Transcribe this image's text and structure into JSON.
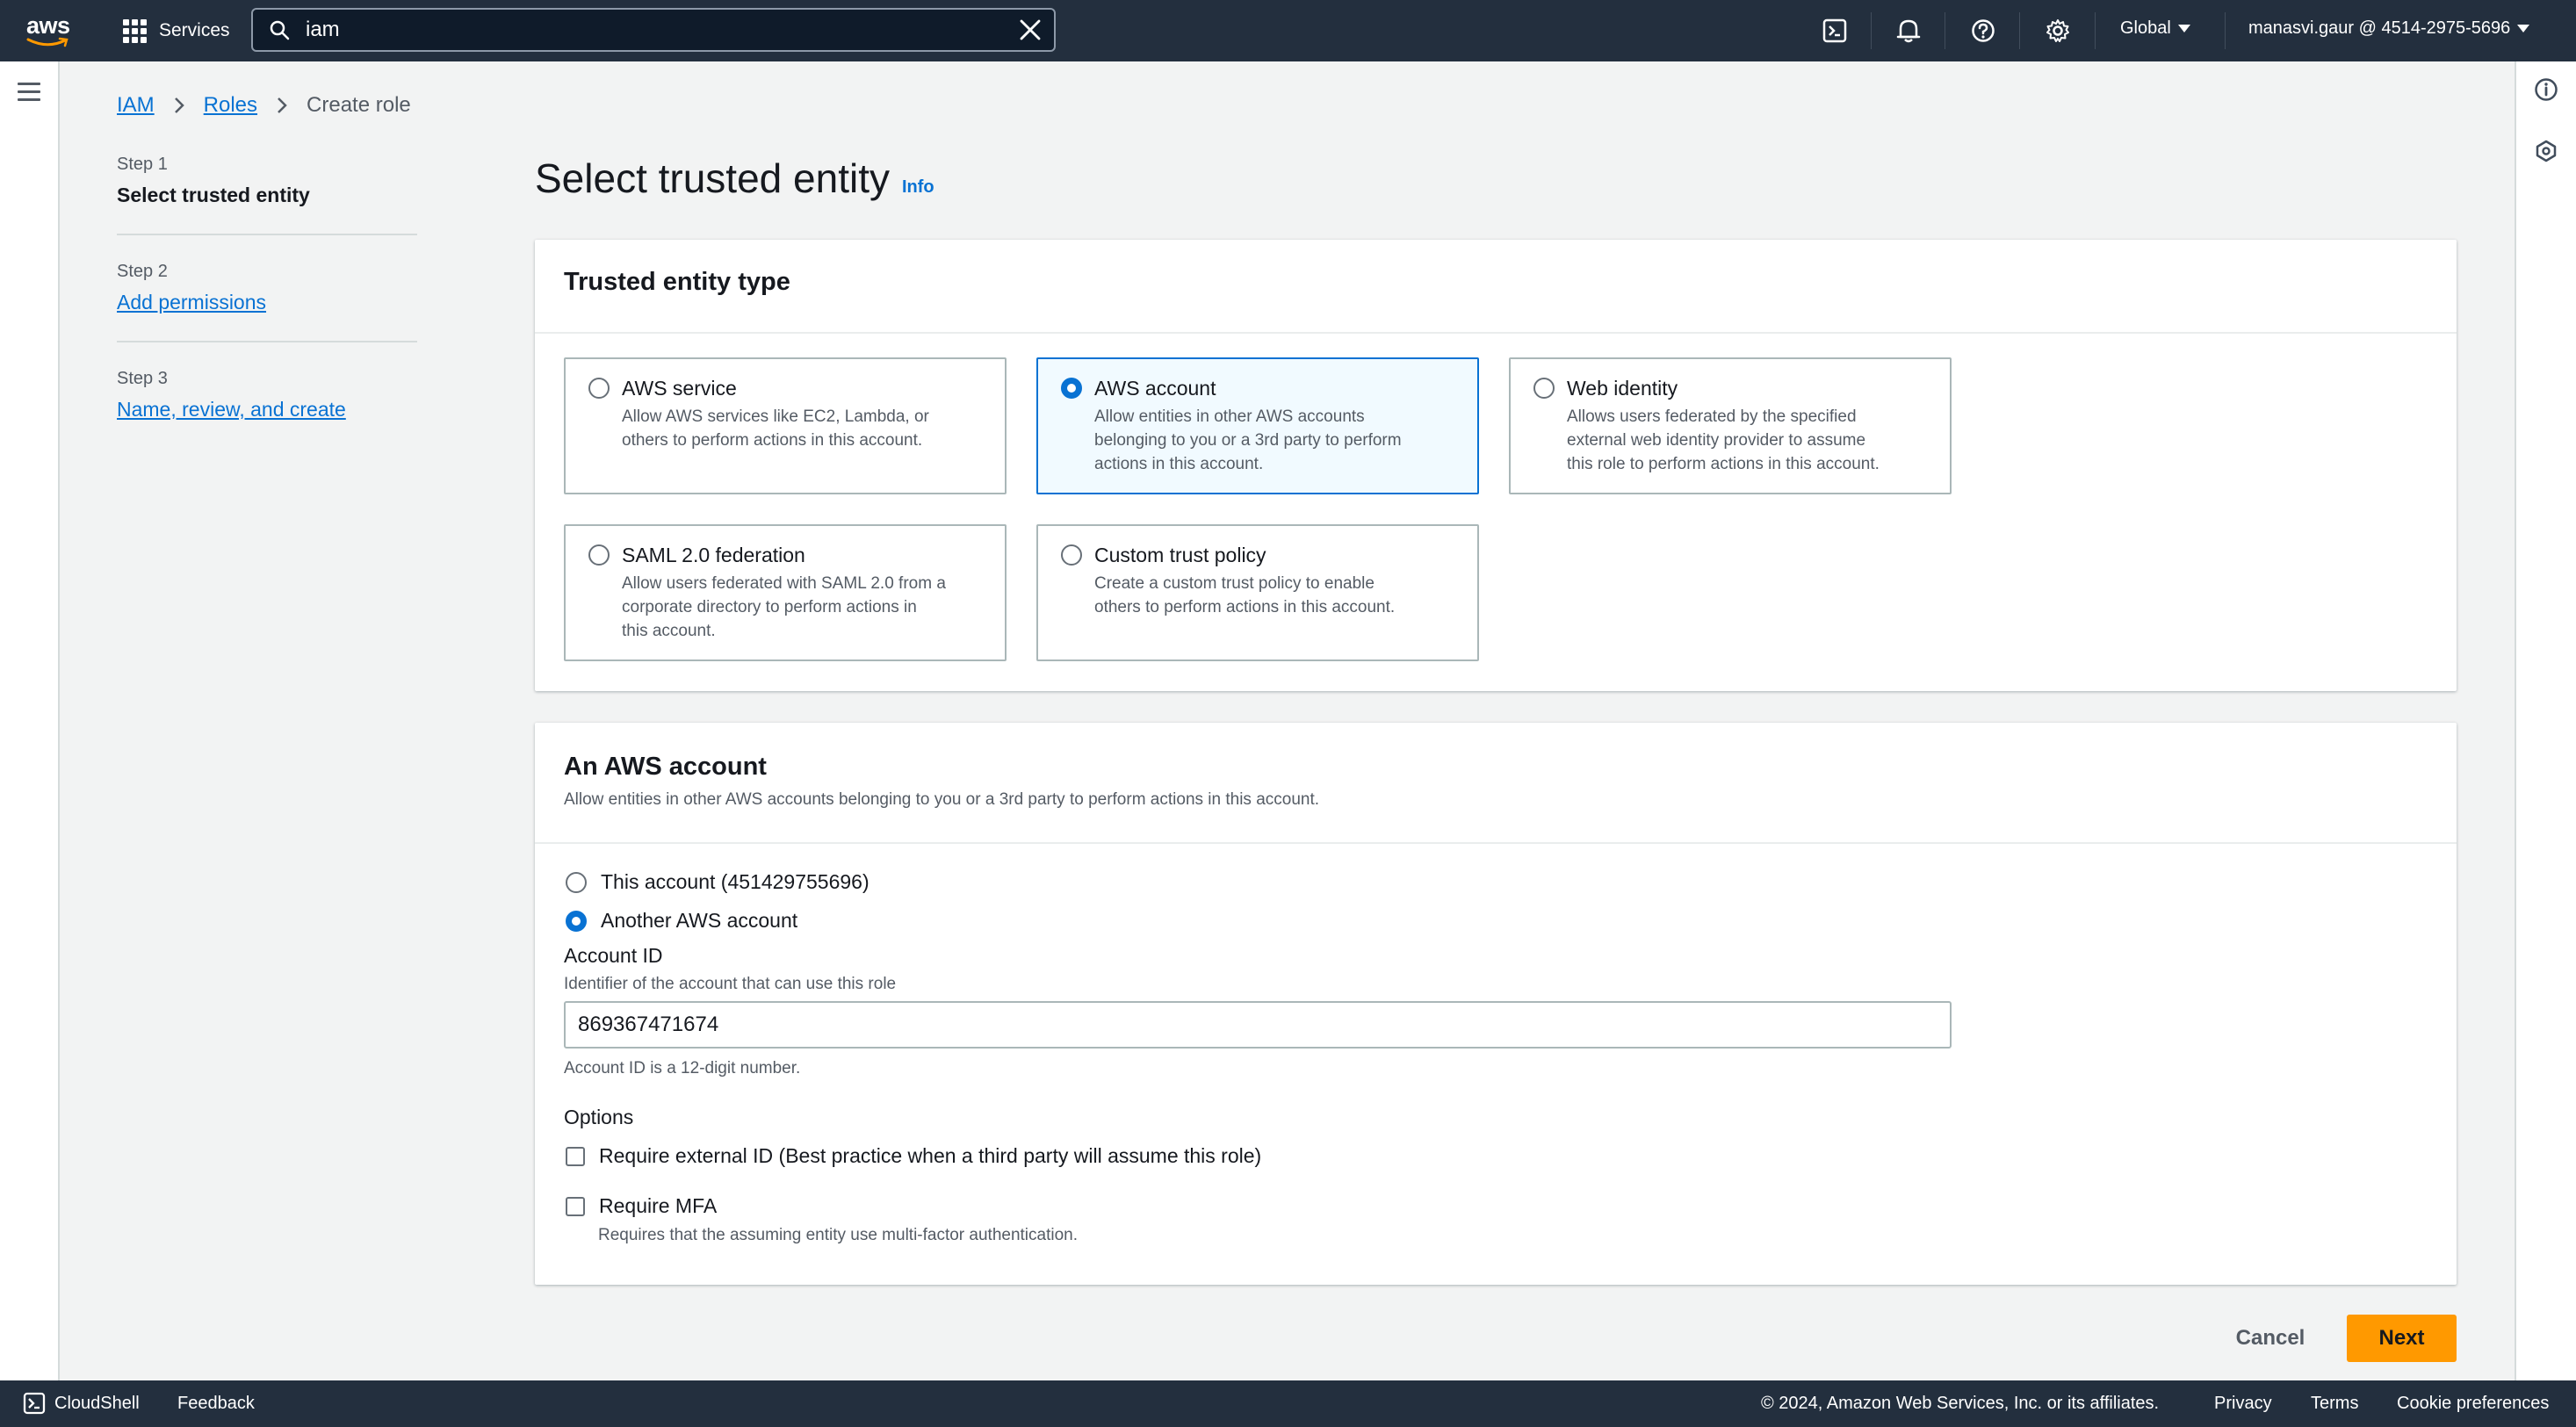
{
  "topnav": {
    "logo_text": "aws",
    "services_label": "Services",
    "search_value": "iam",
    "region_label": "Global",
    "account_label": "manasvi.gaur @ 4514-2975-5696"
  },
  "breadcrumb": {
    "items": [
      "IAM",
      "Roles",
      "Create role"
    ]
  },
  "steps": [
    {
      "num": "Step 1",
      "title": "Select trusted entity"
    },
    {
      "num": "Step 2",
      "title": "Add permissions"
    },
    {
      "num": "Step 3",
      "title": "Name, review, and create"
    }
  ],
  "page": {
    "title": "Select trusted entity",
    "info_label": "Info"
  },
  "trusted_entity": {
    "heading": "Trusted entity type",
    "options": [
      {
        "title": "AWS service",
        "desc_lines": [
          "Allow AWS services like EC2, Lambda, or",
          "others to perform actions in this account."
        ],
        "selected": false
      },
      {
        "title": "AWS account",
        "desc_lines": [
          "Allow entities in other AWS accounts",
          "belonging to you or a 3rd party to perform",
          "actions in this account."
        ],
        "selected": true
      },
      {
        "title": "Web identity",
        "desc_lines": [
          "Allows users federated by the specified",
          "external web identity provider to assume",
          "this role to perform actions in this account."
        ],
        "selected": false
      },
      {
        "title": "SAML 2.0 federation",
        "desc_lines": [
          "Allow users federated with SAML 2.0 from a",
          "corporate directory to perform actions in",
          "this account."
        ],
        "selected": false
      },
      {
        "title": "Custom trust policy",
        "desc_lines": [
          "Create a custom trust policy to enable",
          "others to perform actions in this account."
        ],
        "selected": false
      }
    ]
  },
  "aws_account": {
    "heading": "An AWS account",
    "description": "Allow entities in other AWS accounts belonging to you or a 3rd party to perform actions in this account.",
    "this_account_label": "This account (451429755696)",
    "another_account_label": "Another AWS account",
    "account_id_label": "Account ID",
    "account_id_desc": "Identifier of the account that can use this role",
    "account_id_value": "869367471674",
    "account_id_hint": "Account ID is a 12-digit number.",
    "options_label": "Options",
    "external_id_label": "Require external ID (Best practice when a third party will assume this role)",
    "mfa_label": "Require MFA",
    "mfa_desc": "Requires that the assuming entity use multi-factor authentication."
  },
  "actions": {
    "cancel": "Cancel",
    "next": "Next"
  },
  "footer": {
    "cloudshell": "CloudShell",
    "feedback": "Feedback",
    "copyright": "© 2024, Amazon Web Services, Inc. or its affiliates.",
    "privacy": "Privacy",
    "terms": "Terms",
    "cookies": "Cookie preferences"
  },
  "colors": {
    "nav_bg": "#232f3e",
    "link": "#0972d3",
    "primary_button": "#ff9900",
    "selected_tile_bg": "#f1faff"
  }
}
